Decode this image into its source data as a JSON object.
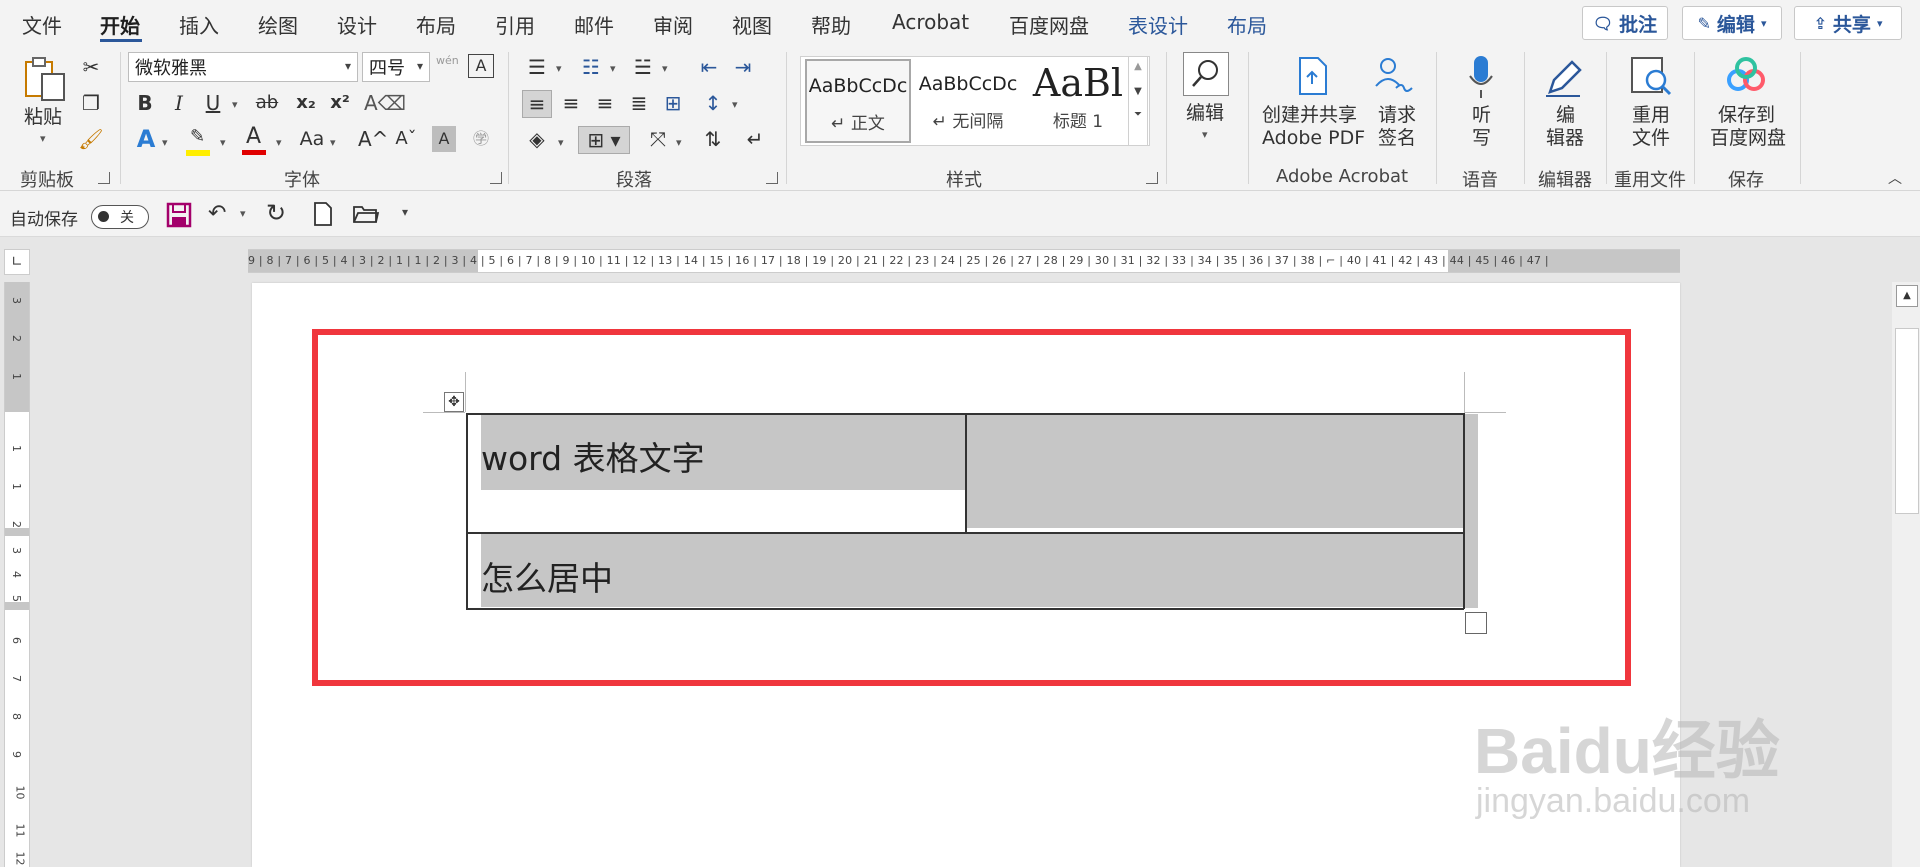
{
  "menu": {
    "tabs": [
      "文件",
      "开始",
      "插入",
      "绘图",
      "设计",
      "布局",
      "引用",
      "邮件",
      "审阅",
      "视图",
      "帮助",
      "Acrobat",
      "百度网盘",
      "表设计",
      "布局"
    ],
    "active_tab": "开始",
    "right_buttons": {
      "comment": "批注",
      "edit": "编辑",
      "share": "共享"
    }
  },
  "ribbon": {
    "clipboard": {
      "paste": "粘贴",
      "group_label": "剪贴板"
    },
    "font": {
      "font_name": "微软雅黑",
      "font_size": "四号",
      "phonetic": "wén",
      "bold": "B",
      "italic": "I",
      "underline": "U",
      "strike": "ab",
      "subscript": "x₂",
      "superscript": "x²",
      "grow": "A^",
      "shrink": "Aˇ",
      "case": "Aa",
      "group_label": "字体"
    },
    "paragraph": {
      "group_label": "段落"
    },
    "styles": {
      "items": [
        {
          "sample": "AaBbCcDc",
          "name": "↵ 正文"
        },
        {
          "sample": "AaBbCcDc",
          "name": "↵ 无间隔"
        },
        {
          "sample": "AaBl",
          "name": "标题 1"
        }
      ],
      "group_label": "样式"
    },
    "editing": {
      "label": "编辑"
    },
    "adobe": {
      "create_share_line1": "创建并共享",
      "create_share_line2": "Adobe PDF",
      "sign_line1": "请求",
      "sign_line2": "签名",
      "group_label": "Adobe Acrobat"
    },
    "voice": {
      "dictate_line1": "听",
      "dictate_line2": "写",
      "group_label": "语音"
    },
    "editor": {
      "line1": "编",
      "line2": "辑器",
      "group_label": "编辑器"
    },
    "reuse": {
      "line1": "重用",
      "line2": "文件",
      "group_label": "重用文件"
    },
    "save": {
      "line1": "保存到",
      "line2": "百度网盘",
      "group_label": "保存"
    }
  },
  "qat": {
    "autosave_label": "自动保存",
    "autosave_state": "关"
  },
  "ruler": {
    "h_text": "9 | 8 | 7 | 6 | 5 | 4 | 3 | 2 | 1     | 1 | 2 | 3 | 4 | 5 | 6 | 7 | 8 | 9 | 10 | 11 | 12 | 13 | 14 | 15 | 16 | 17 | 18 | 19 | 20 | 21 | 22 | 23 | 24 | 25 | 26 | 27 | 28 | 29 | 30 | 31 | 32 | 33 | 34 | 35 | 36 | 37 | 38 | ⌐ | 40 | 41 | 42 | 43 | 44 | 45 | 46 | 47 |",
    "v_numbers": [
      "3",
      "2",
      "1",
      "1",
      "1",
      "2",
      "3",
      "4",
      "5",
      "6",
      "7",
      "8",
      "9",
      "10",
      "11",
      "12"
    ]
  },
  "document": {
    "cell_1": "word 表格文字",
    "cell_2": "",
    "cell_3": "怎么居中"
  },
  "watermark": {
    "line1": "Baidu经验",
    "line2": "jingyan.baidu.com"
  }
}
